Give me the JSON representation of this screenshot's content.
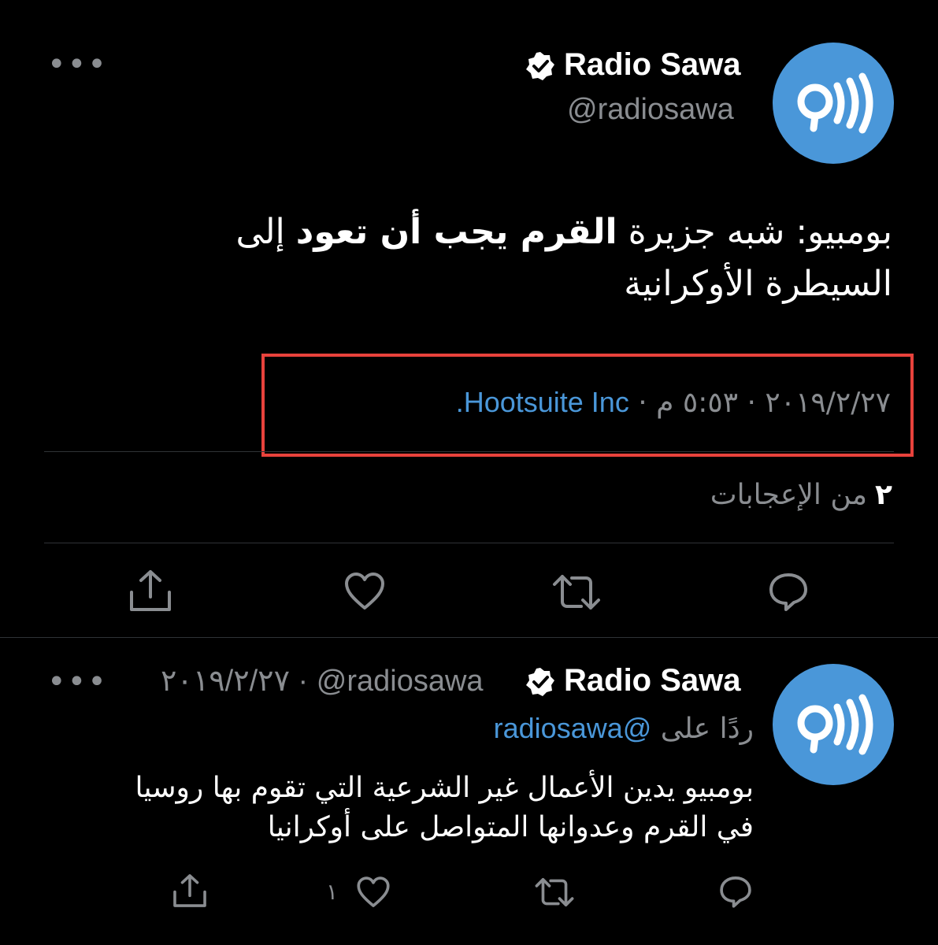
{
  "main_tweet": {
    "author_name": "Radio Sawa",
    "author_handle": "@radiosawa",
    "more_label": "•••",
    "text_part1": "بومبيو: شبه جزيرة ",
    "text_bold1": "القرم يجب أن تعود",
    "text_part2": " إلى",
    "text_line2": "السيطرة الأوكرانية",
    "date": "٢٠١٩/٢/٢٧",
    "time": "٥:٥٣ م",
    "separator": " · ",
    "source": "Hootsuite Inc.",
    "likes_count": "٢",
    "likes_label": "من الإعجابات",
    "highlight_color": "#e8423c"
  },
  "reply_tweet": {
    "author_name": "Radio Sawa",
    "author_handle": "@radiosawa",
    "date": "٢٠١٩/٢/٢٧",
    "separator": " · ",
    "more_label": "•••",
    "reply_prefix": "ردًا على",
    "reply_target": "@radiosawa",
    "text_line1": "بومبيو يدين الأعمال غير الشرعية التي تقوم بها روسيا",
    "text_line2": "في القرم وعدوانها المتواصل على أوكرانيا",
    "like_count": "١"
  },
  "icons": {
    "avatar": "radio-sawa-logo-icon",
    "verified": "verified-badge-icon",
    "reply": "reply-icon",
    "retweet": "retweet-icon",
    "like": "heart-icon",
    "share": "share-icon"
  },
  "colors": {
    "background": "#000000",
    "accent": "#4a97d9",
    "muted": "#8a8d91"
  }
}
